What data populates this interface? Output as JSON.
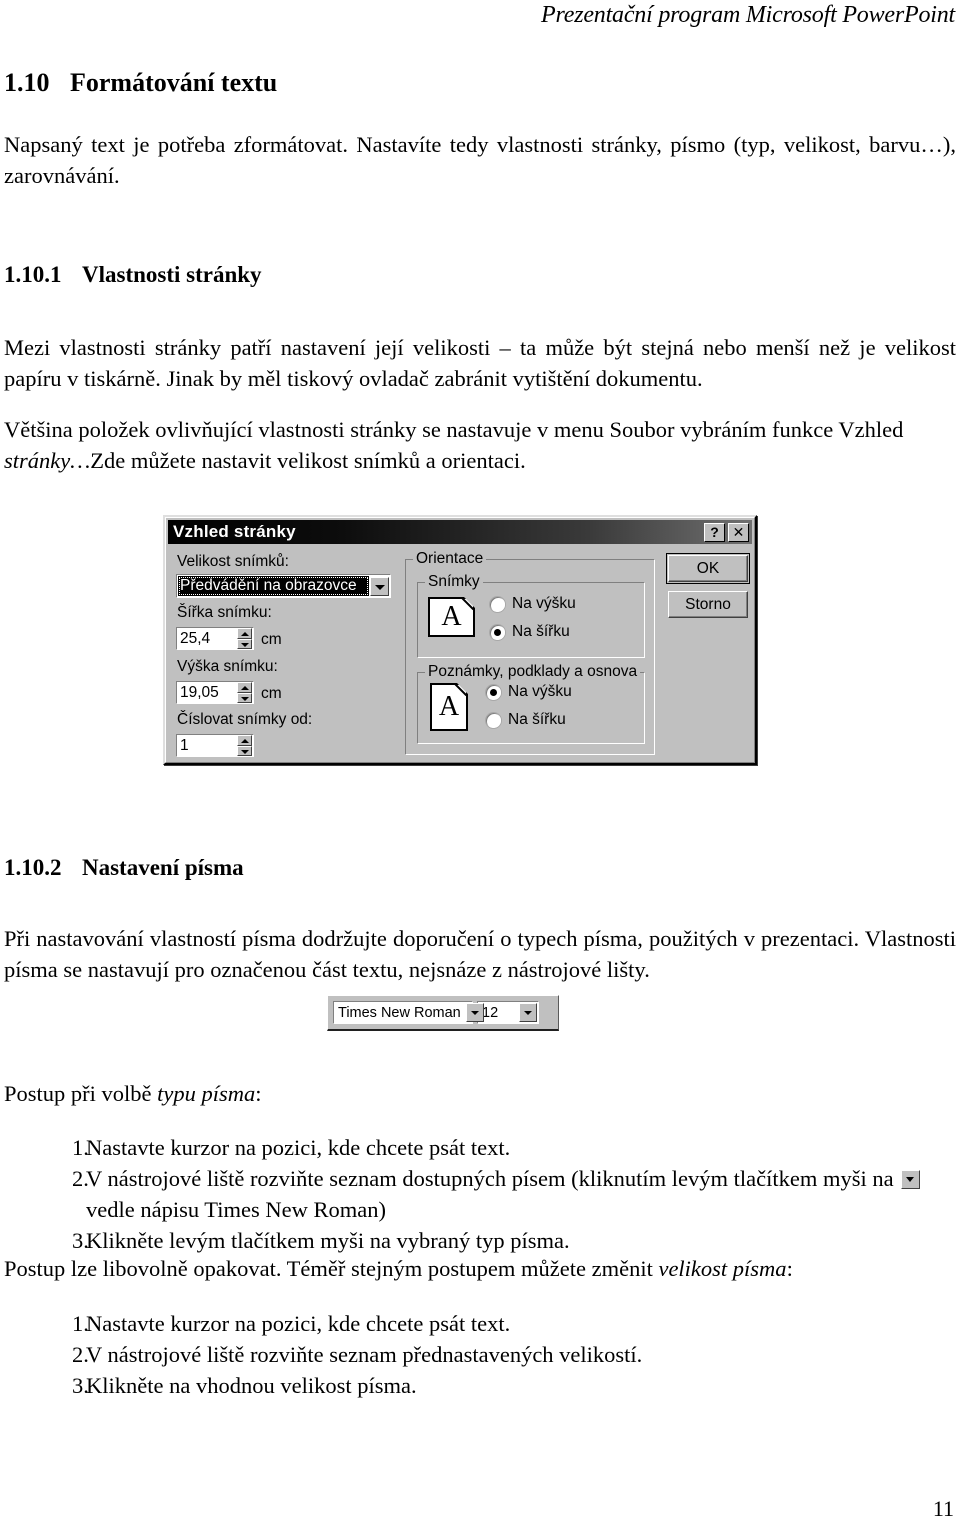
{
  "header": {
    "running_head": "Prezentační program Microsoft PowerPoint"
  },
  "page_number": "11",
  "sections": {
    "s1": {
      "number": "1.10",
      "title": "Formátování textu",
      "body": "Napsaný text je potřeba zformátovat. Nastavíte tedy vlastnosti stránky, písmo (typ, velikost, barvu…), zarovnávání."
    },
    "s2": {
      "number": "1.10.1",
      "title": "Vlastnosti stránky",
      "para1": "Mezi vlastnosti stránky patří nastavení její velikosti – ta může být stejná nebo menší než je velikost papíru v tiskárně. Jinak by měl tiskový ovladač zabránit vytištění dokumentu.",
      "para2_pre": "Většina položek ovlivňující vlastnosti stránky se nastavuje v menu Soubor vybráním funkce Vzhled ",
      "para2_italic": "stránky…",
      "para2_post": "Zde můžete nastavit velikost snímků a orientaci."
    },
    "s3": {
      "number": "1.10.2",
      "title": "Nastavení písma",
      "para1": "Při nastavování vlastností písma dodržujte doporučení o typech písma, použitých v prezentaci. Vlastnosti písma se nastavují pro označenou část textu, nejsnáze z nástrojové lišty.",
      "lead1_pre": "Postup při volbě ",
      "lead1_italic": "typu písma",
      "lead1_post": ":",
      "list1": [
        {
          "mark": "1.",
          "text": "Nastavte kurzor na pozici, kde chcete psát text."
        },
        {
          "mark": "2.",
          "text_pre": "V nástrojové liště rozviňte seznam dostupných písem (kliknutím levým tlačítkem myši na ",
          "text_post": " vedle nápisu Times New Roman)",
          "has_icon": true
        },
        {
          "mark": "3.",
          "text": "Klikněte levým tlačítkem myši na vybraný typ písma."
        }
      ],
      "lead2_pre": "Postup lze libovolně opakovat. Téměř stejným postupem můžete změnit ",
      "lead2_italic": "velikost písma",
      "lead2_post": ":",
      "list2": [
        {
          "mark": "1.",
          "text": "Nastavte kurzor na pozici, kde chcete psát text."
        },
        {
          "mark": "2.",
          "text": "V nástrojové liště rozviňte seznam přednastavených velikostí."
        },
        {
          "mark": "3.",
          "text": "Klikněte na vhodnou velikost písma."
        }
      ]
    }
  },
  "dialog": {
    "title": "Vzhled stránky",
    "titlebar_buttons": [
      {
        "name": "help-button",
        "glyph": "?"
      },
      {
        "name": "close-button",
        "glyph": "✕"
      }
    ],
    "slide_size_label": "Velikost snímků:",
    "slide_size_value": "Předvádění na obrazovce",
    "width_label": "Šířka snímku:",
    "width_value": "25,4",
    "width_unit": "cm",
    "height_label": "Výška snímku:",
    "height_value": "19,05",
    "height_unit": "cm",
    "number_from_label": "Číslovat snímky od:",
    "number_from_value": "1",
    "orientation_group": "Orientace",
    "slides_group": "Snímky",
    "slides_portrait": "Na výšku",
    "slides_landscape": "Na šířku",
    "slides_selected": "Na šířku",
    "notes_group": "Poznámky, podklady a osnova",
    "notes_portrait": "Na výšku",
    "notes_landscape": "Na šířku",
    "notes_selected": "Na výšku",
    "page_icon_letter": "A",
    "ok_label": "OK",
    "cancel_label": "Storno",
    "colors": {
      "face": "#c0c0c0",
      "titlebar_start": "#000000",
      "titlebar_end": "#707070",
      "selection": "#000000"
    }
  },
  "font_toolbar": {
    "font_name": "Times New Roman",
    "font_size": "12"
  }
}
